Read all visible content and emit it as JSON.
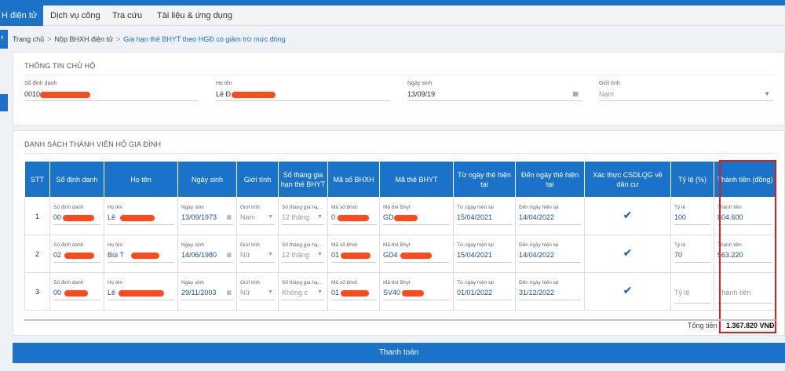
{
  "nav": {
    "items": [
      "H điện tử",
      "Dịch vụ công",
      "Tra cứu",
      "Tài liệu & ứng dụng"
    ]
  },
  "breadcrumb": {
    "home": "Trang chủ",
    "level2": "Nộp BHXH điện tử",
    "current": "Gia hạn thẻ BHYT theo HGĐ có giảm trừ mức đóng"
  },
  "household_head": {
    "section_title": "THÔNG TIN CHỦ HỘ",
    "id_label": "Số định danh",
    "id_value": "0010",
    "name_label": "Họ tên",
    "name_value": "Lê Đ",
    "dob_label": "Ngày sinh",
    "dob_value": "13/09/19",
    "gender_label": "Giới tính",
    "gender_value": "Nam"
  },
  "members": {
    "section_title": "DANH SÁCH THÀNH VIÊN HỘ GIA ĐÌNH",
    "columns": [
      "STT",
      "Số định danh",
      "Họ tên",
      "Ngày sinh",
      "Giới tính",
      "Số tháng gia hạn thẻ BHYT",
      "Mã số BHXH",
      "Mã thẻ BHYT",
      "Từ ngày thẻ hiện tại",
      "Đến ngày thẻ hiện tại",
      "Xác thực CSDLQG về dân cư",
      "Tỷ lệ (%)",
      "Thành tiền (đồng)"
    ],
    "cell_labels": {
      "id": "Số định danh",
      "name": "Họ tên",
      "dob": "Ngày sinh",
      "gender": "Giới tính",
      "months": "Số tháng gia hạ...",
      "bhxh": "Mã số bhxh",
      "card": "Mã thẻ Bhyt",
      "from": "Từ ngày hiện tại",
      "to": "Đến ngày hiện tại",
      "rate": "Tỷ lệ",
      "amount": "Thành tiền"
    },
    "rows": [
      {
        "stt": "1",
        "id": "00",
        "name": "Lê",
        "dob": "13/09/1973",
        "gender": "Nam",
        "months": "12 tháng",
        "bhxh": "0",
        "card": "GD",
        "from": "15/04/2021",
        "to": "14/04/2022",
        "rate": "100",
        "amount": "804.600"
      },
      {
        "stt": "2",
        "id": "02",
        "name": "Bùi T",
        "dob": "14/06/1980",
        "gender": "Nữ",
        "months": "12 tháng",
        "bhxh": "01",
        "card": "GD4",
        "from": "15/04/2021",
        "to": "14/04/2022",
        "rate": "70",
        "amount": "563.220"
      },
      {
        "stt": "3",
        "id": "00",
        "name": "Lê",
        "dob": "29/11/2003",
        "gender": "Nữ",
        "months": "Không c",
        "bhxh": "01",
        "card": "SV40",
        "from": "01/01/2022",
        "to": "31/12/2022",
        "rate": "Tỷ lệ",
        "amount": "Thành tiền"
      }
    ]
  },
  "total": {
    "label": "Tổng tiền",
    "value": "1.367.820 VNĐ"
  },
  "pay_button": "Thanh toán",
  "colors": {
    "brand": "#1a73c8",
    "highlight": "#d42020"
  }
}
